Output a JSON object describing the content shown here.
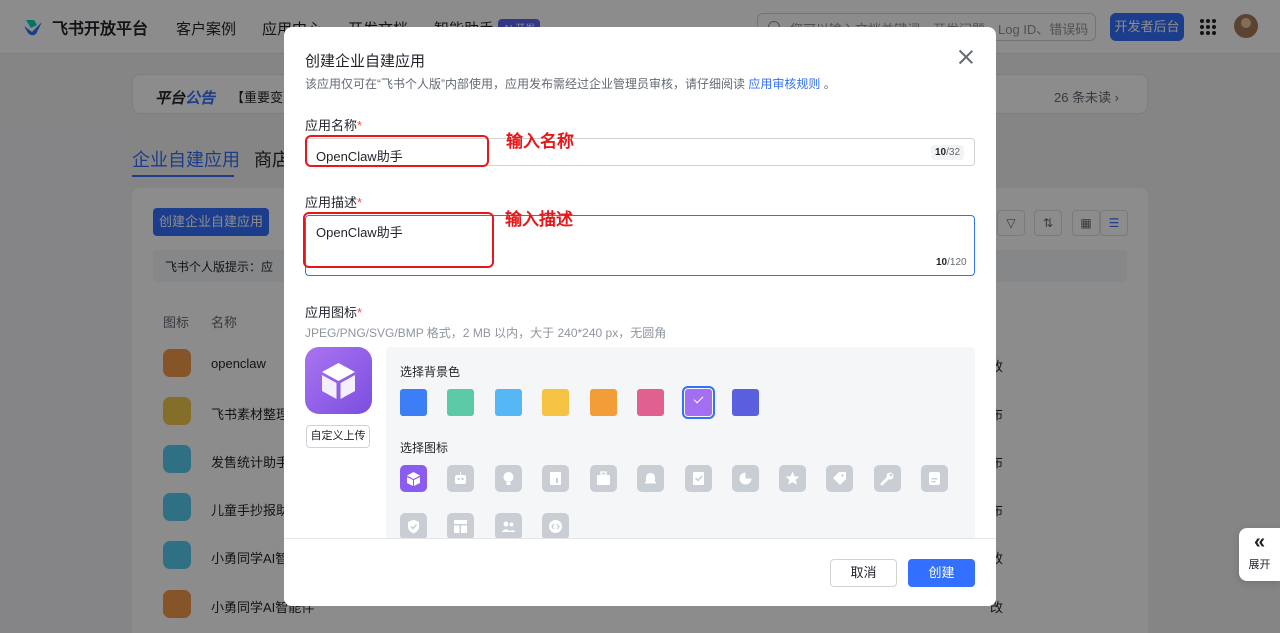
{
  "topbar": {
    "logo_text": "飞书开放平台",
    "nav": [
      "客户案例",
      "应用中心",
      "开发文档",
      "智能助手"
    ],
    "ai_badge": "AI 开发",
    "search_placeholder": "您可以输入文档关键词、开发问题、Log ID、错误码",
    "dev_console": "开发者后台"
  },
  "notice": {
    "label_a": "平台",
    "label_b": "公告",
    "text": "【重要变更】",
    "unread": "26 条未读 ›"
  },
  "page": {
    "tab_self_built": "企业自建应用",
    "tab_store": "商店",
    "create_button": "创建企业自建应用",
    "tip_text": "飞书个人版提示：应",
    "col_icon": "图标",
    "col_name": "名称",
    "rows": [
      {
        "name": "openclaw",
        "tail": "改",
        "color": "#f2994a"
      },
      {
        "name": "飞书素材整理",
        "tail": "布",
        "color": "#f2c94c"
      },
      {
        "name": "发售统计助手",
        "tail": "布",
        "color": "#56ccf2"
      },
      {
        "name": "儿童手抄报助手",
        "tail": "布",
        "color": "#56ccf2"
      },
      {
        "name": "小勇同学AI智能",
        "tail": "改",
        "color": "#56ccf2"
      },
      {
        "name": "小勇同学AI智能伴",
        "tail": "改",
        "color": "#f2994a"
      }
    ]
  },
  "modal": {
    "title": "创建企业自建应用",
    "desc_prefix": "该应用仅可在“飞书个人版”内部使用，应用发布需经过企业管理员审核，请仔细阅读",
    "desc_link": "应用审核规则",
    "desc_suffix": "。",
    "name_label": "应用名称",
    "name_value": "OpenClaw助手",
    "name_count": "10",
    "name_max": "/32",
    "desc_label": "应用描述",
    "desc_value": "OpenClaw助手",
    "desc_count": "10",
    "desc_max": "/120",
    "icon_label": "应用图标",
    "required_mark": "*",
    "icon_hint": "JPEG/PNG/SVG/BMP 格式，2 MB 以内，大于 240*240 px，无圆角",
    "upload_button": "自定义上传",
    "bg_color_label": "选择背景色",
    "bg_colors": [
      "#3b7ef5",
      "#5ccaa6",
      "#56b7f5",
      "#f5c243",
      "#f29d38",
      "#e0608f",
      "#a36ef2",
      "#5a5fe0"
    ],
    "selected_bg_index": 6,
    "icon_choose_label": "选择图标",
    "icons": [
      "cube-icon",
      "robot-icon",
      "lightbulb-icon",
      "document-icon",
      "briefcase-icon",
      "bell-icon",
      "checklist-icon",
      "pie-chart-icon",
      "star-icon",
      "tag-icon",
      "wrench-icon",
      "note-icon",
      "shield-icon",
      "layout-icon",
      "users-icon",
      "code-icon"
    ],
    "cancel": "取消",
    "create": "创建"
  },
  "annotations": {
    "name_label": "输入名称",
    "desc_label": "输入描述"
  },
  "side": {
    "expand_label": "展开"
  }
}
